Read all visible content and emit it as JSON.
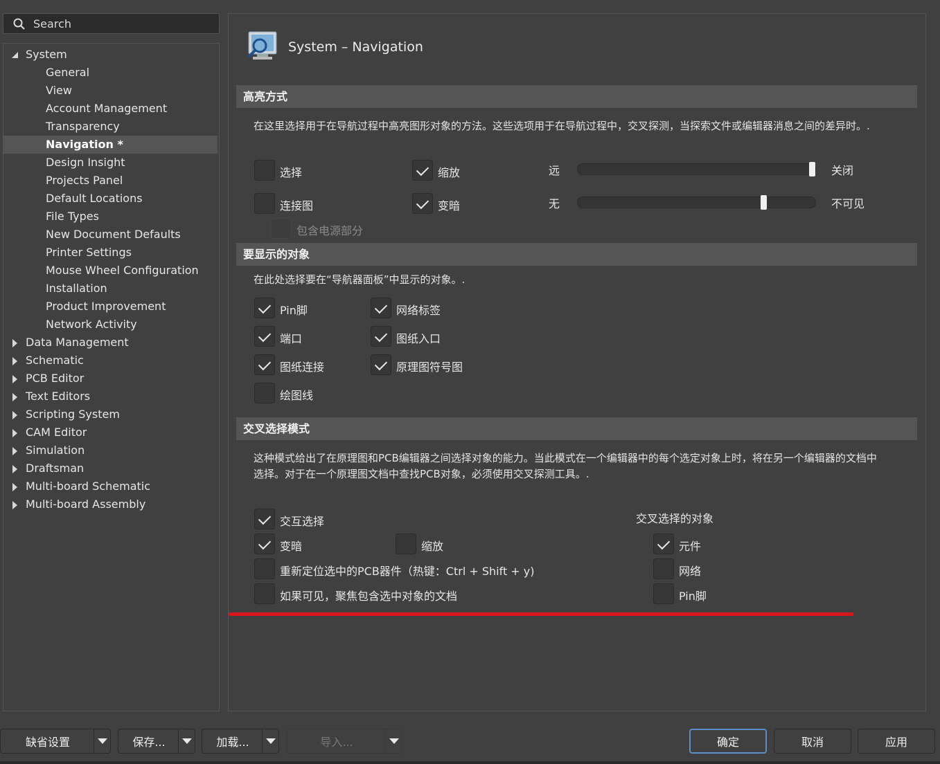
{
  "search": {
    "placeholder": "Search",
    "icon": "search-icon"
  },
  "tree": {
    "system": {
      "label": "System",
      "expanded": true
    },
    "children": [
      "General",
      "View",
      "Account Management",
      "Transparency",
      "Navigation *",
      "Design Insight",
      "Projects Panel",
      "Default Locations",
      "File Types",
      "New Document Defaults",
      "Printer Settings",
      "Mouse Wheel Configuration",
      "Installation",
      "Product Improvement",
      "Network Activity"
    ],
    "selected": "Navigation *",
    "collapsed": [
      "Data Management",
      "Schematic",
      "PCB Editor",
      "Text Editors",
      "Scripting System",
      "CAM Editor",
      "Simulation",
      "Draftsman",
      "Multi-board Schematic",
      "Multi-board Assembly"
    ]
  },
  "header": {
    "title": "System – Navigation",
    "icon": "navigation-monitor-icon"
  },
  "highlight": {
    "title": "高亮方式",
    "desc": "在这里选择用于在导航过程中高亮图形对象的方法。这些选项用于在导航过程中，交叉探测，当探索文件或编辑器消息之间的差异时。.",
    "select": {
      "label": "选择",
      "checked": false
    },
    "zoom": {
      "label": "缩放",
      "checked": true
    },
    "connect": {
      "label": "连接图",
      "checked": false
    },
    "dim": {
      "label": "变暗",
      "checked": true
    },
    "power": {
      "label": "包含电源部分",
      "checked": false,
      "disabled": true
    },
    "slider1": {
      "left": "远",
      "right": "关闭",
      "value": 1.0
    },
    "slider2": {
      "left": "无",
      "right": "不可见",
      "value": 0.79
    }
  },
  "objects": {
    "title": "要显示的对象",
    "desc": "在此处选择要在“导航器面板”中显示的对象。.",
    "pin": {
      "label": "Pin脚",
      "checked": true
    },
    "netlabel": {
      "label": "网络标签",
      "checked": true
    },
    "port": {
      "label": "端口",
      "checked": true
    },
    "sheetentry": {
      "label": "图纸入口",
      "checked": true
    },
    "sheetconn": {
      "label": "图纸连接",
      "checked": true
    },
    "symbol": {
      "label": "原理图符号图",
      "checked": true
    },
    "wire": {
      "label": "绘图线",
      "checked": false
    }
  },
  "cross": {
    "title": "交叉选择模式",
    "desc": "这种模式给出了在原理图和PCB编辑器之间选择对象的能力。当此模式在一个编辑器中的每个选定对象上时，将在另一个编辑器的文档中选择。对于在一个原理图文档中查找PCB对象，必须使用交叉探测工具。.",
    "interactive": {
      "label": "交互选择",
      "checked": true
    },
    "dim": {
      "label": "变暗",
      "checked": true
    },
    "zoom": {
      "label": "缩放",
      "checked": false
    },
    "reposition": {
      "label": "重新定位选中的PCB器件（热键：Ctrl + Shift + y)",
      "checked": false
    },
    "focus": {
      "label": "如果可见，聚焦包含选中对象的文档",
      "checked": false
    },
    "objects_title": "交叉选择的对象",
    "component": {
      "label": "元件",
      "checked": true
    },
    "net": {
      "label": "网络",
      "checked": false
    },
    "pin": {
      "label": "Pin脚",
      "checked": false
    }
  },
  "buttons": {
    "defaults": "缺省设置",
    "save": "保存...",
    "load": "加载...",
    "import": "导入...",
    "ok": "确定",
    "cancel": "取消",
    "apply": "应用"
  },
  "colors": {
    "accent_line": "#d8161c",
    "ok_border": "#5a8ec8"
  }
}
